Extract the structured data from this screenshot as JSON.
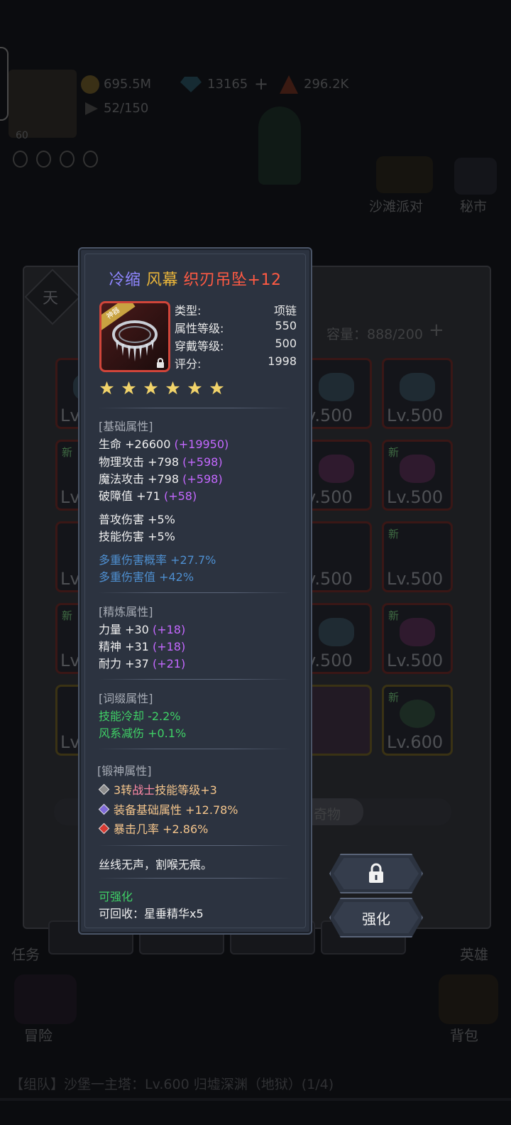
{
  "background": {
    "currency_gold": "695.5M",
    "currency_diamond": "13165",
    "currency_other": "296.2K",
    "stamina": "52/150",
    "player_level": "60",
    "event_label": "沙滩派对",
    "shop_label": "秘市",
    "tab_sky": "天",
    "capacity": "容量：888/200",
    "tab_curio": "奇物",
    "nav_task": "任务",
    "nav_hero": "英雄",
    "nav_adventure": "冒险",
    "nav_bag": "背包",
    "bottom_quest": "【组队】沙堡一主塔：Lv.600 归墟深渊（地狱）(1/4)",
    "slots": [
      {
        "lv": "Lv",
        "new": ""
      },
      {
        "lv": "v.500",
        "new": ""
      },
      {
        "lv": "Lv.500",
        "new": ""
      },
      {
        "lv": "Lv",
        "new": "新"
      },
      {
        "lv": "v.500",
        "new": ""
      },
      {
        "lv": "Lv.500",
        "new": "新"
      },
      {
        "lv": "Lv",
        "new": ""
      },
      {
        "lv": "v.500",
        "new": ""
      },
      {
        "lv": "Lv.500",
        "new": "新"
      },
      {
        "lv": "Lv",
        "new": "新"
      },
      {
        "lv": "v.500",
        "new": ""
      },
      {
        "lv": "Lv.500",
        "new": "新"
      },
      {
        "lv": "Lv",
        "new": ""
      },
      {
        "lv": "",
        "new": ""
      },
      {
        "lv": "Lv.600",
        "new": "新"
      }
    ]
  },
  "tooltip": {
    "title": {
      "part1": "冷缩",
      "part2": "风幕",
      "part3": "织刃吊坠+12"
    },
    "badge": "神器",
    "type_label": "类型:",
    "type_value": "项链",
    "attr_level_label": "属性等级:",
    "attr_level_value": "550",
    "wear_level_label": "穿戴等级:",
    "wear_level_value": "500",
    "score_label": "评分:",
    "score_value": "1998",
    "stars": 6,
    "base_header": "[基础属性]",
    "base": [
      {
        "text": "生命 +26600 ",
        "bonus": "(+19950)"
      },
      {
        "text": "物理攻击 +798 ",
        "bonus": "(+598)"
      },
      {
        "text": "魔法攻击 +798 ",
        "bonus": "(+598)"
      },
      {
        "text": "破障值 +71 ",
        "bonus": "(+58)"
      }
    ],
    "damage": [
      "普攻伤害 +5%",
      "技能伤害 +5%"
    ],
    "multi": [
      "多重伤害概率 +27.7%",
      "多重伤害值 +42%"
    ],
    "refine_header": "[精炼属性]",
    "refine": [
      {
        "text": "力量 +30 ",
        "bonus": "(+18)"
      },
      {
        "text": "精神 +31 ",
        "bonus": "(+18)"
      },
      {
        "text": "耐力 +37 ",
        "bonus": "(+21)"
      }
    ],
    "affix_header": "[词缀属性]",
    "affix": [
      "技能冷却 -2.2%",
      "风系减伤 +0.1%"
    ],
    "forge_header": "[锻神属性]",
    "forge": [
      {
        "pre": "3转",
        "mid": "战士",
        "post": "技能等级+3"
      },
      {
        "pre": "装备基础属性 +12.78%",
        "mid": "",
        "post": ""
      },
      {
        "pre": "暴击几率 +2.86%",
        "mid": "",
        "post": ""
      }
    ],
    "flavor": "丝线无声，割喉无痕。",
    "enhanceable": "可强化",
    "recycle": "可回收：星垂精华x5"
  },
  "buttons": {
    "enhance": "强化"
  },
  "colors": {
    "panel": "#2c3340",
    "border": "#4a5466",
    "star": "#f1d36a",
    "frame_red": "#d0453a"
  }
}
